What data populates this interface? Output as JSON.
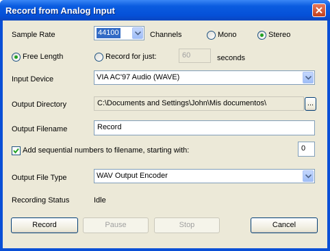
{
  "window": {
    "title": "Record from Analog Input"
  },
  "sample_rate": {
    "label": "Sample Rate",
    "value": "44100"
  },
  "channels": {
    "label": "Channels",
    "mono_label": "Mono",
    "stereo_label": "Stereo",
    "selected": "Stereo"
  },
  "length": {
    "free_label": "Free Length",
    "record_for_label": "Record for just:",
    "seconds_value": "60",
    "seconds_label": "seconds",
    "selected": "Free Length"
  },
  "input_device": {
    "label": "Input Device",
    "value": "VIA AC'97 Audio (WAVE)"
  },
  "output_directory": {
    "label": "Output Directory",
    "value": "C:\\Documents and Settings\\John\\Mis documentos\\",
    "browse_label": "..."
  },
  "output_filename": {
    "label": "Output Filename",
    "value": "Record"
  },
  "sequential": {
    "label": "Add sequential numbers to filename, starting with:",
    "checked": true,
    "start_value": "0"
  },
  "output_file_type": {
    "label": "Output File Type",
    "value": "WAV Output Encoder"
  },
  "recording_status": {
    "label": "Recording Status",
    "value": "Idle"
  },
  "buttons": {
    "record": "Record",
    "pause": "Pause",
    "stop": "Stop",
    "cancel": "Cancel"
  },
  "colors": {
    "titlebar": "#0550d8",
    "dialog_bg": "#ece9d8",
    "radio_dot": "#21a121",
    "selection": "#316ac5"
  }
}
